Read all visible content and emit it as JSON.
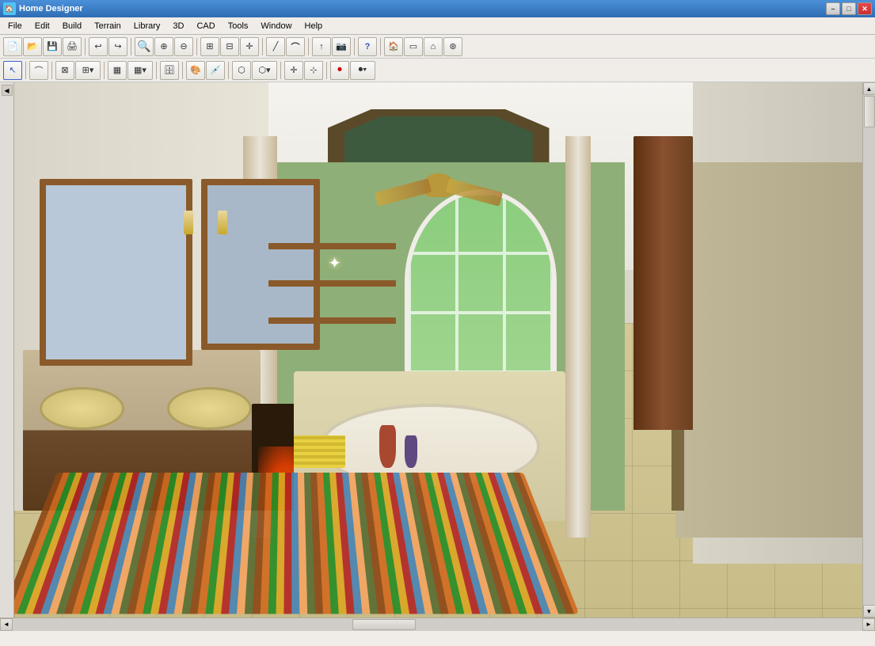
{
  "window": {
    "title": "Home Designer",
    "icon": "🏠"
  },
  "titlebar": {
    "title": "Home Designer",
    "min_label": "–",
    "max_label": "□",
    "close_label": "✕"
  },
  "menubar": {
    "items": [
      {
        "id": "file",
        "label": "File"
      },
      {
        "id": "edit",
        "label": "Edit"
      },
      {
        "id": "build",
        "label": "Build"
      },
      {
        "id": "terrain",
        "label": "Terrain"
      },
      {
        "id": "library",
        "label": "Library"
      },
      {
        "id": "3d",
        "label": "3D"
      },
      {
        "id": "cad",
        "label": "CAD"
      },
      {
        "id": "tools",
        "label": "Tools"
      },
      {
        "id": "window",
        "label": "Window"
      },
      {
        "id": "help",
        "label": "Help"
      }
    ]
  },
  "toolbar1": {
    "buttons": [
      {
        "id": "new",
        "icon": "📄",
        "tooltip": "New"
      },
      {
        "id": "open",
        "icon": "📂",
        "tooltip": "Open"
      },
      {
        "id": "save",
        "icon": "💾",
        "tooltip": "Save"
      },
      {
        "id": "print",
        "icon": "🖨",
        "tooltip": "Print"
      },
      {
        "id": "undo",
        "icon": "↩",
        "tooltip": "Undo"
      },
      {
        "id": "redo",
        "icon": "↪",
        "tooltip": "Redo"
      },
      {
        "id": "zoom-in",
        "icon": "🔍",
        "tooltip": "Zoom In"
      },
      {
        "id": "zoom-window",
        "icon": "⊕",
        "tooltip": "Zoom Window"
      },
      {
        "id": "zoom-out",
        "icon": "⊖",
        "tooltip": "Zoom Out"
      },
      {
        "id": "fit",
        "icon": "⊞",
        "tooltip": "Fit"
      },
      {
        "id": "select-all",
        "icon": "⊟",
        "tooltip": "Select All"
      },
      {
        "id": "move",
        "icon": "+",
        "tooltip": "Move"
      },
      {
        "id": "line",
        "icon": "╱",
        "tooltip": "Line"
      },
      {
        "id": "arc",
        "icon": "⌒",
        "tooltip": "Arc"
      },
      {
        "id": "arrow",
        "icon": "↑",
        "tooltip": "Arrow"
      },
      {
        "id": "camera",
        "icon": "📷",
        "tooltip": "Camera"
      },
      {
        "id": "help2",
        "icon": "?",
        "tooltip": "Help"
      },
      {
        "id": "exterior",
        "icon": "🏠",
        "tooltip": "Exterior"
      },
      {
        "id": "floor",
        "icon": "▭",
        "tooltip": "Floor"
      },
      {
        "id": "roof",
        "icon": "⌂",
        "tooltip": "Roof"
      }
    ]
  },
  "toolbar2": {
    "buttons": [
      {
        "id": "select",
        "icon": "↖",
        "tooltip": "Select Objects"
      },
      {
        "id": "polyline",
        "icon": "⌒",
        "tooltip": "Polyline"
      },
      {
        "id": "walls",
        "icon": "⊞",
        "tooltip": "Walls"
      },
      {
        "id": "rooms",
        "icon": "▦",
        "tooltip": "Rooms"
      },
      {
        "id": "cabinet",
        "icon": "🗄",
        "tooltip": "Cabinet"
      },
      {
        "id": "material",
        "icon": "◎",
        "tooltip": "Material Painter"
      },
      {
        "id": "terrain2",
        "icon": "⬡",
        "tooltip": "Terrain"
      },
      {
        "id": "stairs",
        "icon": "↑",
        "tooltip": "Stairs"
      },
      {
        "id": "move2",
        "icon": "✛",
        "tooltip": "Move"
      },
      {
        "id": "record",
        "icon": "⏺",
        "tooltip": "Record"
      }
    ]
  },
  "statusbar": {
    "text": ""
  },
  "scrollbar": {
    "up_label": "▲",
    "down_label": "▼",
    "left_label": "◄",
    "right_label": "►"
  },
  "render": {
    "description": "3D bathroom interior render"
  }
}
